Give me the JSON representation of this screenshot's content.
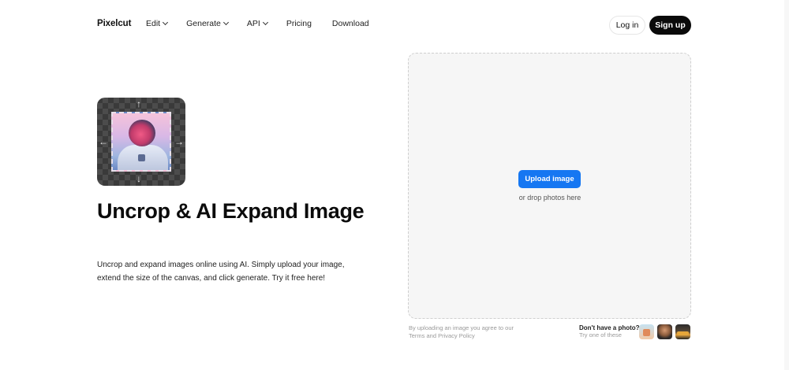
{
  "header": {
    "logo": "Pixelcut",
    "nav": [
      {
        "label": "Edit",
        "has_menu": true
      },
      {
        "label": "Generate",
        "has_menu": true
      },
      {
        "label": "API",
        "has_menu": true
      },
      {
        "label": "Pricing",
        "has_menu": false
      },
      {
        "label": "Download",
        "has_menu": false
      }
    ],
    "login_label": "Log in",
    "signup_label": "Sign up"
  },
  "hero": {
    "title": "Uncrop & AI Expand Image",
    "description": "Uncrop and expand images online using AI. Simply upload your image, extend the size of the canvas, and click generate. Try it free here!",
    "arrows": {
      "up": "↑",
      "down": "↓",
      "left": "←",
      "right": "→"
    }
  },
  "upload": {
    "button_label": "Upload image",
    "drop_text": "or drop photos here",
    "terms_text": "By uploading an image you agree to our Terms and Privacy Policy",
    "samples_title": "Don't have a photo?",
    "samples_subtitle": "Try one of these"
  }
}
